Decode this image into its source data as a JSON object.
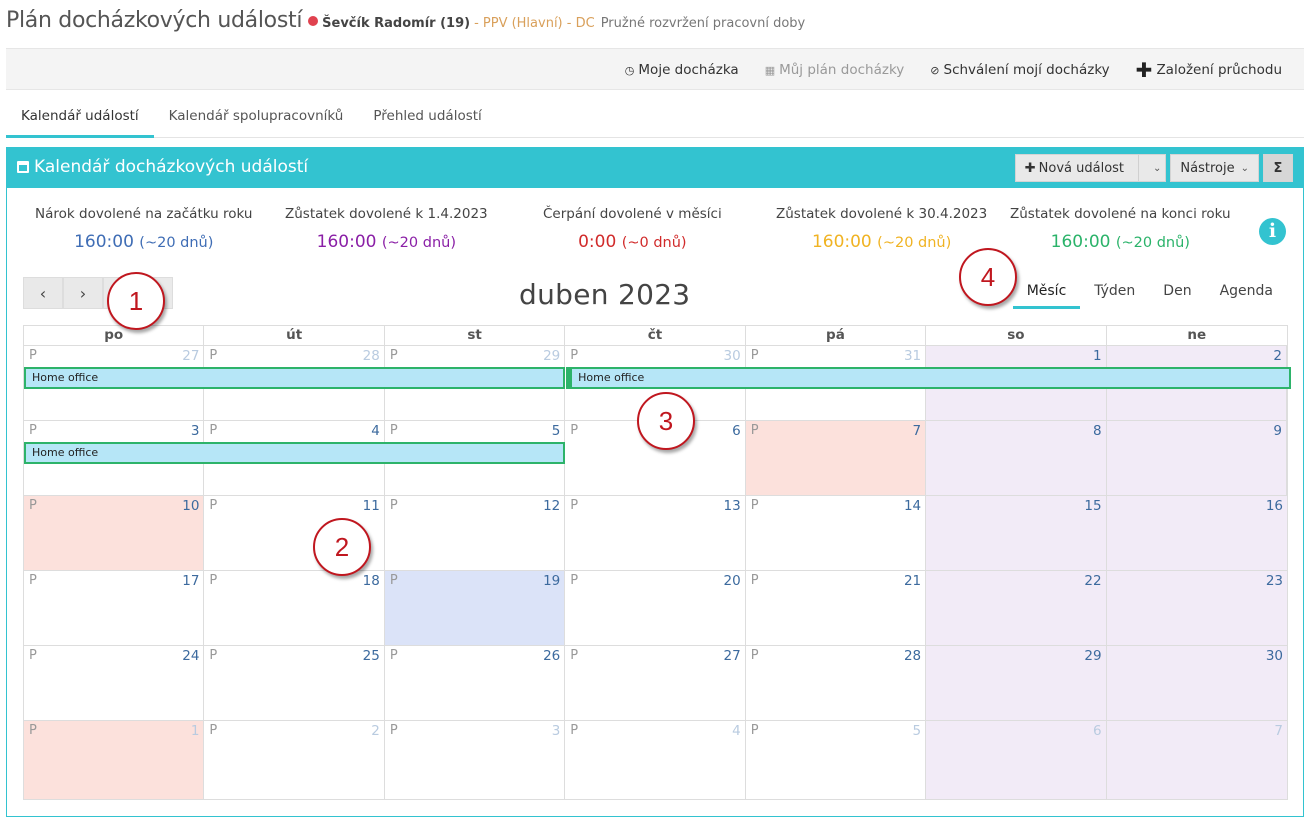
{
  "header": {
    "title": "Plán docházkových událostí",
    "person": "Ševčík Radomír (19)",
    "org": "- PPV (Hlavní) - DC",
    "worktype": "Pružné rozvržení pracovní doby"
  },
  "topbar": {
    "actions": [
      {
        "label": "Moje docházka",
        "icon": "clock-icon"
      },
      {
        "label": "Můj plán docházky",
        "icon": "calendar-icon"
      },
      {
        "label": "Schválení mojí docházky",
        "icon": "check-circle-icon"
      },
      {
        "label": "Založení průchodu",
        "icon": "plus-icon"
      }
    ]
  },
  "tabs": [
    "Kalendář událostí",
    "Kalendář spolupracovníků",
    "Přehled událostí"
  ],
  "panel": {
    "title": "Kalendář docházkových událostí",
    "new_event": "Nová událost",
    "tools": "Nástroje",
    "sigma": "Σ"
  },
  "stats": [
    {
      "label": "Nárok dovolené na začátku roku",
      "value": "160:00",
      "sub": "(~20 dnů)",
      "color": "#3f6db5"
    },
    {
      "label": "Zůstatek dovolené k 1.4.2023",
      "value": "160:00",
      "sub": "(~20 dnů)",
      "color": "#8a1fa6"
    },
    {
      "label": "Čerpání dovolené v měsíci",
      "value": "0:00",
      "sub": "(~0 dnů)",
      "color": "#d12b2b"
    },
    {
      "label": "Zůstatek dovolené k 30.4.2023",
      "value": "160:00",
      "sub": "(~20 dnů)",
      "color": "#f0b323"
    },
    {
      "label": "Zůstatek dovolené na konci roku",
      "value": "160:00",
      "sub": "(~20 dnů)",
      "color": "#2bb36a"
    }
  ],
  "calendar": {
    "month_title": "duben 2023",
    "nav_prev": "‹",
    "nav_next": "›",
    "views": [
      "Měsíc",
      "Týden",
      "Den",
      "Agenda"
    ],
    "active_view": "Měsíc",
    "days_of_week": [
      "po",
      "út",
      "st",
      "čt",
      "pá",
      "so",
      "ne"
    ],
    "day_marker": "P",
    "weeks": [
      [
        {
          "d": "27",
          "o": true
        },
        {
          "d": "28",
          "o": true
        },
        {
          "d": "29",
          "o": true
        },
        {
          "d": "30",
          "o": true
        },
        {
          "d": "31",
          "o": true
        },
        {
          "d": "1",
          "w": true
        },
        {
          "d": "2",
          "w": true
        }
      ],
      [
        {
          "d": "3"
        },
        {
          "d": "4"
        },
        {
          "d": "5"
        },
        {
          "d": "6"
        },
        {
          "d": "7",
          "h": true
        },
        {
          "d": "8",
          "w": true
        },
        {
          "d": "9",
          "w": true
        }
      ],
      [
        {
          "d": "10",
          "h": true
        },
        {
          "d": "11"
        },
        {
          "d": "12"
        },
        {
          "d": "13"
        },
        {
          "d": "14"
        },
        {
          "d": "15",
          "w": true
        },
        {
          "d": "16",
          "w": true
        }
      ],
      [
        {
          "d": "17"
        },
        {
          "d": "18"
        },
        {
          "d": "19",
          "t": true
        },
        {
          "d": "20"
        },
        {
          "d": "21"
        },
        {
          "d": "22",
          "w": true
        },
        {
          "d": "23",
          "w": true
        }
      ],
      [
        {
          "d": "24"
        },
        {
          "d": "25"
        },
        {
          "d": "26"
        },
        {
          "d": "27"
        },
        {
          "d": "28"
        },
        {
          "d": "29",
          "w": true
        },
        {
          "d": "30",
          "w": true
        }
      ],
      [
        {
          "d": "1",
          "o": true,
          "h": true
        },
        {
          "d": "2",
          "o": true
        },
        {
          "d": "3",
          "o": true
        },
        {
          "d": "4",
          "o": true
        },
        {
          "d": "5",
          "o": true
        },
        {
          "d": "6",
          "o": true,
          "w": true
        },
        {
          "d": "7",
          "o": true,
          "w": true
        }
      ]
    ],
    "events": [
      {
        "label": "Home office",
        "week": 0,
        "start": 0,
        "span": 3
      },
      {
        "label": "Home office",
        "week": 0,
        "start": 3,
        "span": 4,
        "continues": true
      },
      {
        "label": "Home office",
        "week": 1,
        "start": 0,
        "span": 3
      }
    ]
  },
  "callouts": [
    "1",
    "2",
    "3",
    "4"
  ]
}
